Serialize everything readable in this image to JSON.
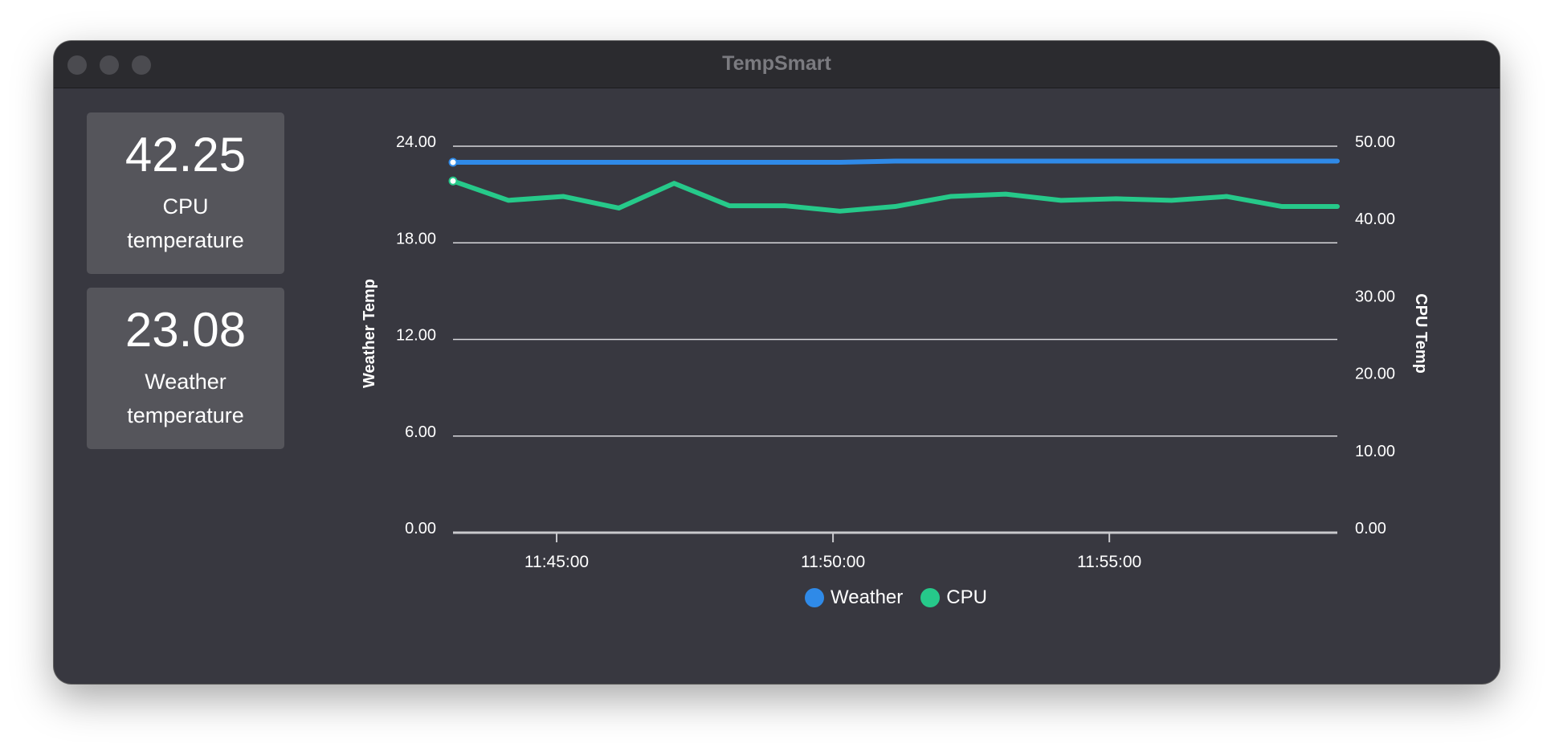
{
  "window": {
    "title": "TempSmart"
  },
  "stats": {
    "cpu": {
      "value": "42.25",
      "label_line1": "CPU",
      "label_line2": "temperature"
    },
    "weather": {
      "value": "23.08",
      "label_line1": "Weather",
      "label_line2": "temperature"
    }
  },
  "legend": {
    "weather": "Weather",
    "cpu": "CPU"
  },
  "colors": {
    "weather": "#2f8ae8",
    "cpu": "#26c98a",
    "window_bg": "#383840",
    "card_bg": "#55555b"
  },
  "chart_data": {
    "type": "line",
    "title": "",
    "left_axis": {
      "label": "Weather Temp",
      "ylim": [
        0,
        24
      ],
      "ticks": [
        "0.00",
        "6.00",
        "12.00",
        "18.00",
        "24.00"
      ]
    },
    "right_axis": {
      "label": "CPU Temp",
      "ylim": [
        0,
        50
      ],
      "ticks": [
        "0.00",
        "10.00",
        "20.00",
        "30.00",
        "40.00",
        "50.00"
      ]
    },
    "x_axis": {
      "ticks": [
        "11:45:00",
        "11:50:00",
        "11:55:00"
      ],
      "tick_positions": [
        1.875,
        6.875,
        11.875
      ],
      "xlim": [
        0,
        16
      ]
    },
    "grid": true,
    "legend_position": "bottom-center",
    "series": [
      {
        "name": "Weather",
        "axis": "left",
        "x": [
          0,
          1,
          2,
          3,
          4,
          5,
          6,
          7,
          8,
          9,
          10,
          11,
          12,
          13,
          14,
          15,
          16
        ],
        "values": [
          23.0,
          23.0,
          23.0,
          23.0,
          23.0,
          23.0,
          23.0,
          23.0,
          23.08,
          23.08,
          23.08,
          23.08,
          23.08,
          23.08,
          23.08,
          23.08,
          23.08
        ]
      },
      {
        "name": "CPU",
        "axis": "right",
        "x": [
          0,
          1,
          2,
          3,
          4,
          5,
          6,
          7,
          8,
          9,
          10,
          11,
          12,
          13,
          14,
          15,
          16
        ],
        "values": [
          45.5,
          43.0,
          43.5,
          42.0,
          45.2,
          42.3,
          42.3,
          41.6,
          42.2,
          43.5,
          43.8,
          43.0,
          43.2,
          43.0,
          43.5,
          42.2,
          42.2
        ]
      }
    ]
  }
}
